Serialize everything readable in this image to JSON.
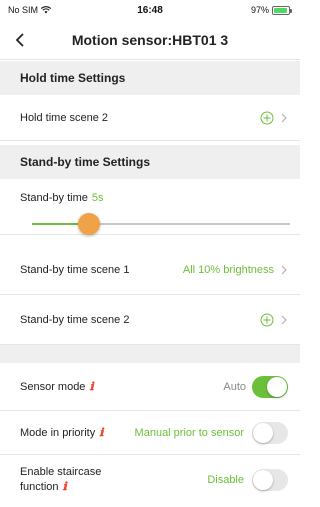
{
  "status": {
    "carrier": "No SIM",
    "time": "16:48",
    "battery": "97%"
  },
  "nav": {
    "title": "Motion sensor:HBT01 3"
  },
  "hold_section": {
    "title": "Hold time Settings",
    "scene2_label": "Hold time scene 2"
  },
  "standby_section": {
    "title": "Stand-by time Settings"
  },
  "standby_slider": {
    "label": "Stand-by time",
    "value": "5s",
    "level_fraction": 0.22
  },
  "standby_scene1": {
    "label": "Stand-by time scene 1",
    "value": "All 10% brightness"
  },
  "standby_scene2": {
    "label": "Stand-by time scene 2"
  },
  "sensor_mode": {
    "label": "Sensor mode",
    "value": "Auto",
    "enabled": true
  },
  "mode_priority": {
    "label": "Mode in priority",
    "value": "Manual prior to sensor",
    "enabled": false
  },
  "staircase": {
    "label_line1": "Enable staircase",
    "label_line2": "function",
    "value": "Disable",
    "enabled": false
  },
  "colors": {
    "accent_green": "#6cbf3a",
    "thumb_orange": "#f0a346",
    "info_red": "#e8462e",
    "section_bg": "#efefef"
  }
}
